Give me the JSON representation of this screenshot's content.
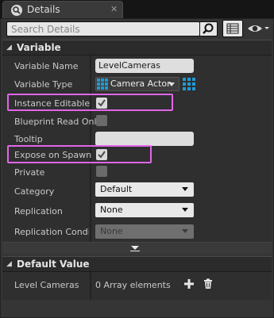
{
  "tab": {
    "title": "Details",
    "close": "✕"
  },
  "search": {
    "placeholder": "Search Details"
  },
  "sections": {
    "variable": {
      "title": "Variable"
    },
    "default_value": {
      "title": "Default Value"
    }
  },
  "variable": {
    "name_label": "Variable Name",
    "name_value": "LevelCameras",
    "type_label": "Variable Type",
    "type_value": "Camera Actor",
    "instance_editable_label": "Instance Editable",
    "instance_editable": true,
    "blueprint_read_only_label": "Blueprint Read Only",
    "blueprint_read_only": false,
    "tooltip_label": "Tooltip",
    "tooltip_value": "",
    "expose_on_spawn_label": "Expose on Spawn",
    "expose_on_spawn": true,
    "private_label": "Private",
    "private": false,
    "category_label": "Category",
    "category_value": "Default",
    "replication_label": "Replication",
    "replication_value": "None",
    "replication_condition_label": "Replication Condition",
    "replication_condition_value": "None"
  },
  "default_value": {
    "label": "Level Cameras",
    "value": "0 Array elements"
  },
  "colors": {
    "highlight": "#e066e8",
    "array_pin": "#1f9ad6"
  },
  "icons": [
    "details-icon",
    "close-icon",
    "search-icon",
    "list-view-icon",
    "eye-icon",
    "array-type-icon",
    "add-icon",
    "trash-icon"
  ]
}
